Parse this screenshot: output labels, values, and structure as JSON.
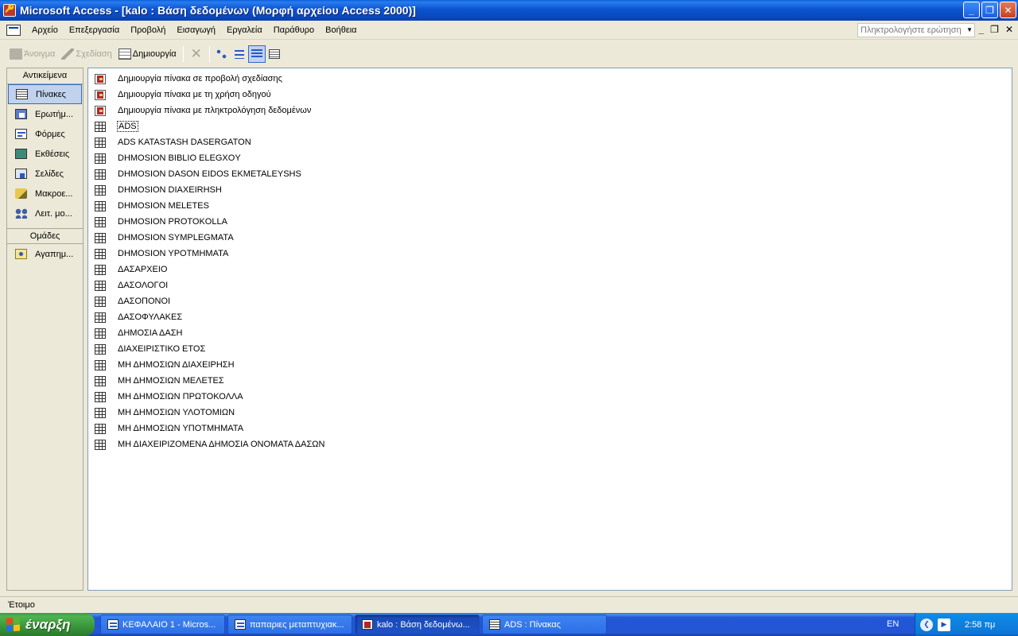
{
  "window": {
    "title": "Microsoft Access - [kalo : Βάση δεδομένων (Μορφή αρχείου Access 2000)]",
    "buttons": [
      "_",
      "❐",
      "✕"
    ]
  },
  "menubar": {
    "items": [
      "Αρχείο",
      "Επεξεργασία",
      "Προβολή",
      "Εισαγωγή",
      "Εργαλεία",
      "Παράθυρο",
      "Βοήθεια"
    ],
    "help_placeholder": "Πληκτρολογήστε ερώτηση",
    "mdi_buttons": [
      "_",
      "❐",
      "✕"
    ]
  },
  "toolbar": {
    "open_label": "Άνοιγμα",
    "design_label": "Σχεδίαση",
    "new_label": "Δημιουργία",
    "delete_glyph": "✕"
  },
  "objects_bar": {
    "header": "Αντικείμενα",
    "items": [
      {
        "label": "Πίνακες",
        "icon": "table-icon",
        "selected": true
      },
      {
        "label": "Ερωτήμ...",
        "icon": "query-icon"
      },
      {
        "label": "Φόρμες",
        "icon": "form-icon"
      },
      {
        "label": "Εκθέσεις",
        "icon": "report-icon"
      },
      {
        "label": "Σελίδες",
        "icon": "page-icon"
      },
      {
        "label": "Μακροε...",
        "icon": "macro-icon"
      },
      {
        "label": "Λειτ. μο...",
        "icon": "module-icon"
      }
    ],
    "groups_header": "Ομάδες",
    "groups": [
      {
        "label": "Αγαπημ...",
        "icon": "favorites-icon"
      }
    ]
  },
  "list": {
    "shortcuts": [
      "Δημιουργία πίνακα σε προβολή σχεδίασης",
      "Δημιουργία πίνακα με τη χρήση οδηγού",
      "Δημιουργία πίνακα με πληκτρολόγηση δεδομένων"
    ],
    "tables": [
      "ADS",
      "ADS KATASTASH DASERGATON",
      "DHMOSION BIBLIO ELEGXOY",
      "DHMOSION DASON EIDOS EKMETALEYSHS",
      "DHMOSION DIAXEIRHSH",
      "DHMOSION MELETES",
      "DHMOSION PROTOKOLLA",
      "DHMOSION SYMPLEGMATA",
      "DHMOSION YPOTMHMATA",
      "ΔΑΣΑΡΧΕΙΟ",
      "ΔΑΣΟΛΟΓΟΙ",
      "ΔΑΣΟΠΟΝΟΙ",
      "ΔΑΣΟΦΥΛΑΚΕΣ",
      "ΔΗΜΟΣΙΑ ΔΑΣΗ",
      "ΔΙΑΧΕΙΡΙΣΤΙΚΟ ΕΤΟΣ",
      "ΜΗ ΔΗΜΟΣΙΩΝ ΔΙΑΧΕΙΡΗΣΗ",
      "ΜΗ ΔΗΜΟΣΙΩΝ ΜΕΛΕΤΕΣ",
      "ΜΗ ΔΗΜΟΣΙΩΝ ΠΡΩΤΟΚΟΛΛΑ",
      "ΜΗ ΔΗΜΟΣΙΩΝ ΥΛΟΤΟΜΙΩΝ",
      "ΜΗ ΔΗΜΟΣΙΩΝ ΥΠΟΤΜΗΜΑΤΑ",
      "ΜΗ ΔΙΑΧΕΙΡΙΖΟΜΕΝΑ ΔΗΜΟΣΙΑ ΟΝΟΜΑΤΑ ΔΑΣΩΝ"
    ],
    "focused_item": "ADS"
  },
  "status": {
    "text": "Έτοιμο"
  },
  "taskbar": {
    "start_label": "έναρξη",
    "tasks": [
      {
        "label": "ΚΕΦΑΛΑΙΟ 1 - Micros...",
        "icon": "word"
      },
      {
        "label": "παπαριες μεταπτυχιακ...",
        "icon": "word"
      },
      {
        "label": "kalo : Βάση δεδομένω...",
        "icon": "access",
        "active": true
      },
      {
        "label": "ADS : Πίνακας",
        "icon": "table"
      }
    ],
    "language": "EN",
    "clock": "2:58 πμ"
  }
}
